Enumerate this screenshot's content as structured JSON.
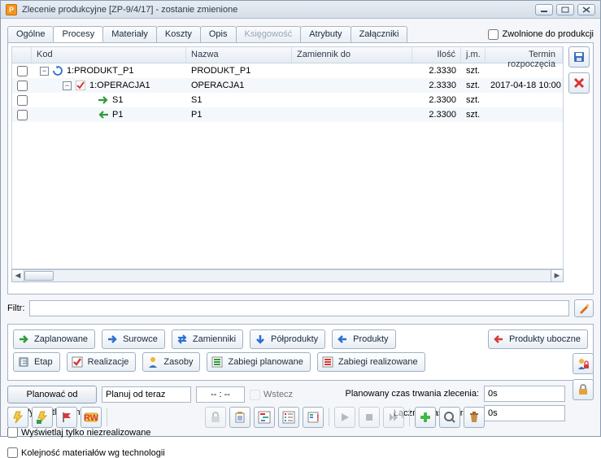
{
  "titlebar": {
    "title": "Zlecenie produkcyjne  [ZP-9/4/17]  - zostanie zmienione"
  },
  "tabs": {
    "general": "Ogólne",
    "processes": "Procesy",
    "materials": "Materiały",
    "costs": "Koszty",
    "desc": "Opis",
    "accounting": "Księgowość",
    "attrs": "Atrybuty",
    "attach": "Załączniki"
  },
  "released_chk": "Zwolnione do produkcji",
  "columns": {
    "kod": "Kod",
    "nazwa": "Nazwa",
    "zam": "Zamiennik do",
    "qty": "Ilość",
    "jm": "j.m.",
    "term": "Termin rozpoczęcia"
  },
  "rows": [
    {
      "indent": 0,
      "toggle": "−",
      "icon": "cycle-blue",
      "kod": "1:PRODUKT_P1",
      "nazwa": "PRODUKT_P1",
      "qty": "2.3330",
      "jm": "szt.",
      "term": ""
    },
    {
      "indent": 1,
      "toggle": "−",
      "icon": "check-red",
      "kod": "1:OPERACJA1",
      "nazwa": "OPERACJA1",
      "qty": "2.3330",
      "jm": "szt.",
      "term": "2017-04-18 10:00"
    },
    {
      "indent": 2,
      "toggle": "",
      "icon": "arrow-green-r",
      "kod": "S1",
      "nazwa": "S1",
      "qty": "2.3300",
      "jm": "szt.",
      "term": ""
    },
    {
      "indent": 2,
      "toggle": "",
      "icon": "arrow-green-l",
      "kod": "P1",
      "nazwa": "P1",
      "qty": "2.3300",
      "jm": "szt.",
      "term": ""
    }
  ],
  "filter_label": "Filtr:",
  "filter_value": "",
  "buttons": {
    "zaplanowane": "Zaplanowane",
    "surowce": "Surowce",
    "zamienniki": "Zamienniki",
    "polprodukty": "Półprodukty",
    "produkty": "Produkty",
    "uboczne": "Produkty uboczne",
    "etap": "Etap",
    "realizacje": "Realizacje",
    "zasoby": "Zasoby",
    "zabiegi_plan": "Zabiegi planowane",
    "zabiegi_real": "Zabiegi realizowane"
  },
  "plan": {
    "btn": "Planować od",
    "input_label": "Planuj od teraz",
    "time": "-- : --",
    "back": "Wstecz"
  },
  "checks": {
    "conflicts": "Wyświetlaj konflikty",
    "unrealized": "Wyświetlaj tylko niezrealizowane",
    "mat_order": "Kolejność materiałów wg technologii"
  },
  "summary": {
    "planned_label": "Planowany czas trwania zlecenia:",
    "planned_val": "0s",
    "total_label": "Łączny czas operacji:",
    "total_val": "0s"
  }
}
